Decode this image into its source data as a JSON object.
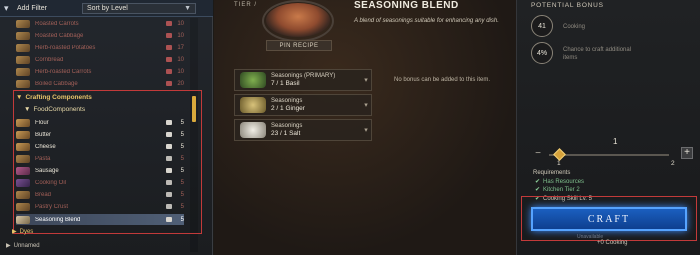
{
  "toolbar": {
    "add_filter": "Add Filter",
    "sort": "Sort by Level"
  },
  "list": {
    "top_items": [
      {
        "name": "Roasted Carrots",
        "qty": "10"
      },
      {
        "name": "Roasted Cabbage",
        "qty": "10"
      },
      {
        "name": "Herb-roasted Potatoes",
        "qty": "17"
      },
      {
        "name": "Cornbread",
        "qty": "10"
      },
      {
        "name": "Herb-roasted Carrots",
        "qty": "10"
      },
      {
        "name": "Boiled Cabbage",
        "qty": "20"
      }
    ],
    "category": "Crafting Components",
    "subcategory": "FoodComponents",
    "food_items": [
      {
        "name": "Flour",
        "qty": "5"
      },
      {
        "name": "Butter",
        "qty": "5"
      },
      {
        "name": "Cheese",
        "qty": "5"
      },
      {
        "name": "Pasta",
        "qty": "5"
      },
      {
        "name": "Sausage",
        "qty": "5"
      },
      {
        "name": "Cooking Oil",
        "qty": "5"
      },
      {
        "name": "Bread",
        "qty": "5"
      },
      {
        "name": "Pastry Crust",
        "qty": "5"
      },
      {
        "name": "Seasoning Blend",
        "qty": "5"
      }
    ],
    "dyes": "Dyes",
    "unnamed": "Unnamed"
  },
  "recipe": {
    "tier": "TIER /",
    "pin": "PIN RECIPE",
    "title": "SEASONING BLEND",
    "description": "A blend of seasonings suitable for enhancing any dish.",
    "ingredients": [
      {
        "label": "Seasonings (PRIMARY)",
        "amount": "7 / 1  Basil"
      },
      {
        "label": "Seasonings",
        "amount": "2 / 1  Ginger"
      },
      {
        "label": "Seasonings",
        "amount": "23 / 1  Salt"
      }
    ],
    "no_bonus": "No bonus can be added to this item."
  },
  "bonus": {
    "title": "POTENTIAL BONUS",
    "items": [
      {
        "value": "41",
        "text": "Cooking"
      },
      {
        "value": "4%",
        "text": "Chance to craft additional items"
      }
    ]
  },
  "quantity": {
    "value": "1",
    "min": "1",
    "max": "2",
    "position": 0.05
  },
  "requirements": {
    "title": "Requirements",
    "items": [
      "Has Resources",
      "Kitchen Tier 2",
      "Cooking Skill Lv. 5"
    ]
  },
  "craft": {
    "label": "CRAFT",
    "sub": "Unavailable",
    "xp": "+0 Cooking"
  },
  "colors": {
    "accent_gold": "#d9a93c",
    "craft_blue": "#1b5fbf",
    "highlight_red": "#c23a3a",
    "ok_green": "#7fbf8c"
  }
}
